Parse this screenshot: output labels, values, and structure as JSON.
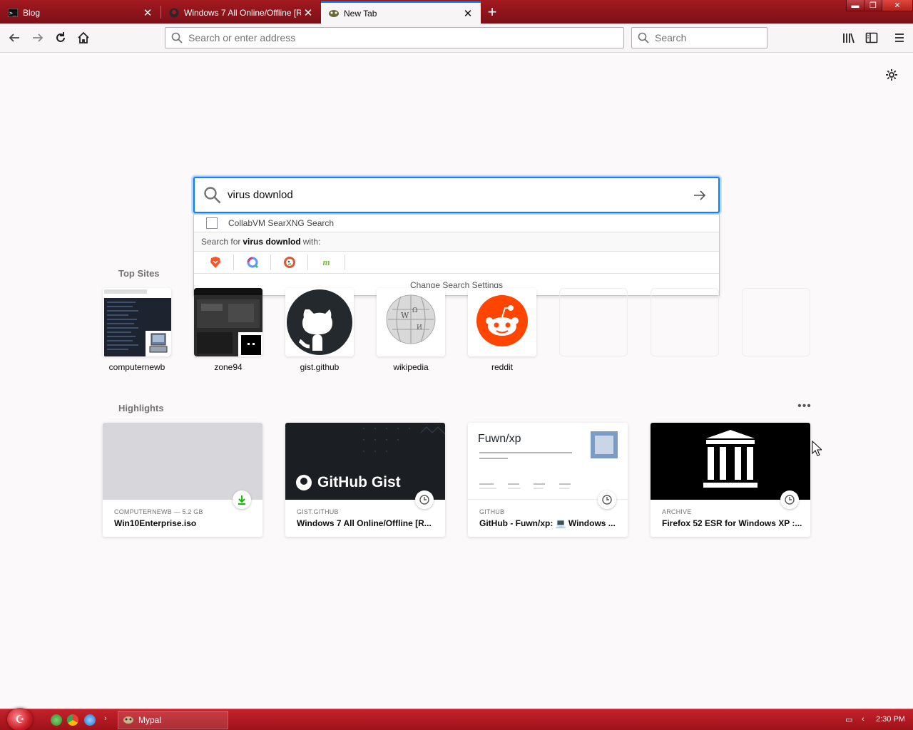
{
  "tabs": [
    {
      "label": "Blog",
      "favicon": "terminal-favicon-icon",
      "active": false
    },
    {
      "label": "Windows 7 All Online/Offline [R...",
      "favicon": "github-favicon-icon",
      "active": false
    },
    {
      "label": "New Tab",
      "favicon": "firefox-favicon-icon",
      "active": true
    }
  ],
  "window_controls": {
    "minimize": "▬",
    "maximize": "❐",
    "close": "✕"
  },
  "nav": {
    "url_placeholder": "Search or enter address",
    "search_placeholder": "Search"
  },
  "big_search": {
    "value": "virus downlod"
  },
  "suggestions": {
    "first_row": "CollabVM SearXNG Search",
    "search_for_prefix": "Search for",
    "search_for_term": "virus downlod",
    "search_for_suffix": "with:",
    "engines": [
      "brave-icon",
      "qwant-icon",
      "duckduckgo-icon",
      "mojeek-icon"
    ],
    "change_settings": "Change Search Settings"
  },
  "top_sites": {
    "title": "Top Sites",
    "items": [
      {
        "label": "computernewb"
      },
      {
        "label": "zone94"
      },
      {
        "label": "gist.github"
      },
      {
        "label": "wikipedia"
      },
      {
        "label": "reddit"
      }
    ]
  },
  "highlights": {
    "title": "Highlights",
    "more": "•••",
    "cards": [
      {
        "context": "COMPUTERNEWB — 5.2 GB",
        "title": "Win10Enterprise.iso",
        "badge": "download-icon"
      },
      {
        "context": "GIST.GITHUB",
        "title": "Windows 7 All Online/Offline [R...",
        "thumb_text": "GitHub Gist",
        "badge": "history-icon"
      },
      {
        "context": "GITHUB",
        "title": "GitHub - Fuwn/xp: 💻 Windows ...",
        "thumb_text": "Fuwn/xp",
        "badge": "history-icon"
      },
      {
        "context": "ARCHIVE",
        "title": "Firefox 52 ESR for Windows XP :...",
        "badge": "history-icon"
      }
    ]
  },
  "taskbar": {
    "task_label": "Mypal",
    "clock": "2:30 PM"
  },
  "colors": {
    "accent": "#0a84ff",
    "titlebar": "#a31920",
    "taskbar": "#c4222b"
  }
}
